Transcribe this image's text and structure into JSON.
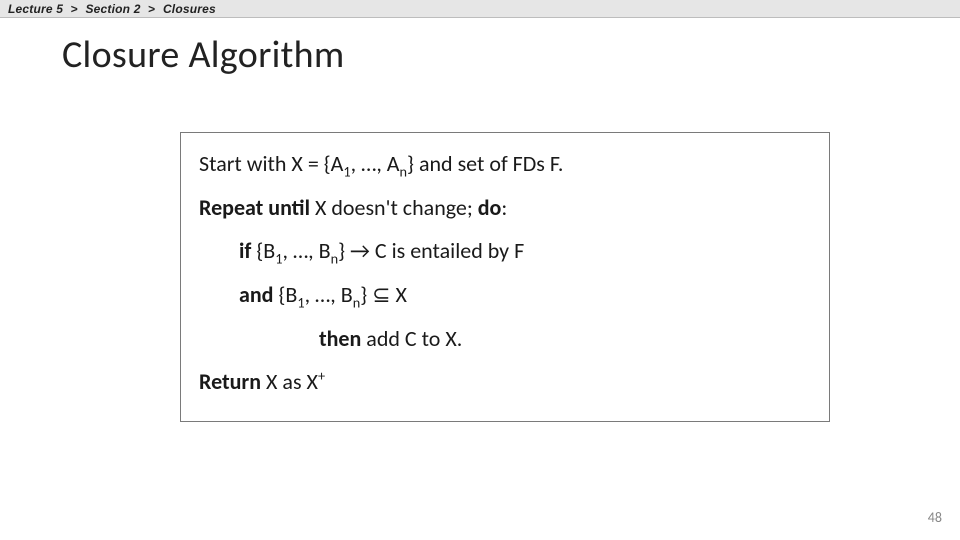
{
  "breadcrumb": {
    "item1": "Lecture 5",
    "sep": ">",
    "item2": "Section 2",
    "item3": "Closures"
  },
  "title": "Closure Algorithm",
  "algorithm": {
    "line1": {
      "pre": "Start with X = {A",
      "sub1": "1",
      "mid": ", …, A",
      "sub2": "n",
      "post": "} and set of FDs F."
    },
    "line2": {
      "boldA": "Repeat until",
      "mid": " X doesn't change; ",
      "boldB": "do",
      "post": ":"
    },
    "line3": {
      "bold": "if",
      "pre": "  {B",
      "sub1": "1",
      "mid": ", …, B",
      "sub2": "n",
      "post": "} → C is entailed by F"
    },
    "line4": {
      "bold": "and",
      "pre": " {B",
      "sub1": "1",
      "mid": ", …, B",
      "sub2": "n",
      "post": "} ⊆ X"
    },
    "line5": {
      "bold": "then",
      "post": "  add C to X."
    },
    "line6": {
      "bold": "Return",
      "mid": " X as X",
      "sup": "+"
    }
  },
  "page_number": "48"
}
